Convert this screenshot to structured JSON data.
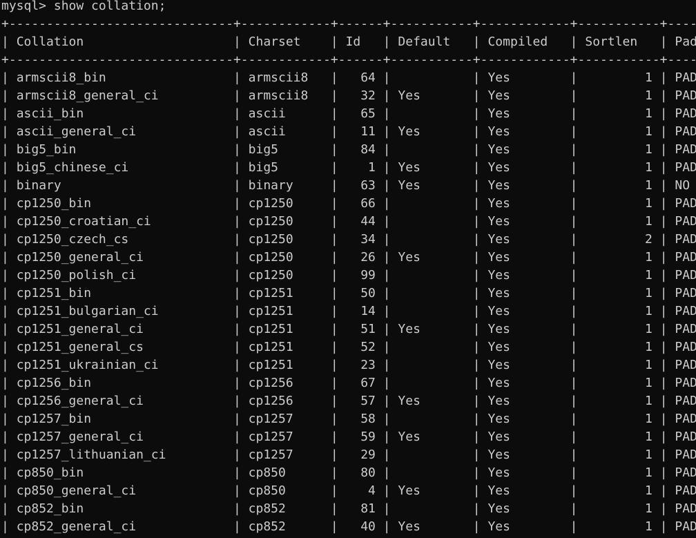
{
  "prompt": "mysql> show collation;",
  "columns": [
    "Collation",
    "Charset",
    "Id",
    "Default",
    "Compiled",
    "Sortlen",
    "Pad_attribute"
  ],
  "rows": [
    [
      "armscii8_bin",
      "armscii8",
      "64",
      "",
      "Yes",
      "1",
      "PAD SPACE"
    ],
    [
      "armscii8_general_ci",
      "armscii8",
      "32",
      "Yes",
      "Yes",
      "1",
      "PAD SPACE"
    ],
    [
      "ascii_bin",
      "ascii",
      "65",
      "",
      "Yes",
      "1",
      "PAD SPACE"
    ],
    [
      "ascii_general_ci",
      "ascii",
      "11",
      "Yes",
      "Yes",
      "1",
      "PAD SPACE"
    ],
    [
      "big5_bin",
      "big5",
      "84",
      "",
      "Yes",
      "1",
      "PAD SPACE"
    ],
    [
      "big5_chinese_ci",
      "big5",
      "1",
      "Yes",
      "Yes",
      "1",
      "PAD SPACE"
    ],
    [
      "binary",
      "binary",
      "63",
      "Yes",
      "Yes",
      "1",
      "NO PAD"
    ],
    [
      "cp1250_bin",
      "cp1250",
      "66",
      "",
      "Yes",
      "1",
      "PAD SPACE"
    ],
    [
      "cp1250_croatian_ci",
      "cp1250",
      "44",
      "",
      "Yes",
      "1",
      "PAD SPACE"
    ],
    [
      "cp1250_czech_cs",
      "cp1250",
      "34",
      "",
      "Yes",
      "2",
      "PAD SPACE"
    ],
    [
      "cp1250_general_ci",
      "cp1250",
      "26",
      "Yes",
      "Yes",
      "1",
      "PAD SPACE"
    ],
    [
      "cp1250_polish_ci",
      "cp1250",
      "99",
      "",
      "Yes",
      "1",
      "PAD SPACE"
    ],
    [
      "cp1251_bin",
      "cp1251",
      "50",
      "",
      "Yes",
      "1",
      "PAD SPACE"
    ],
    [
      "cp1251_bulgarian_ci",
      "cp1251",
      "14",
      "",
      "Yes",
      "1",
      "PAD SPACE"
    ],
    [
      "cp1251_general_ci",
      "cp1251",
      "51",
      "Yes",
      "Yes",
      "1",
      "PAD SPACE"
    ],
    [
      "cp1251_general_cs",
      "cp1251",
      "52",
      "",
      "Yes",
      "1",
      "PAD SPACE"
    ],
    [
      "cp1251_ukrainian_ci",
      "cp1251",
      "23",
      "",
      "Yes",
      "1",
      "PAD SPACE"
    ],
    [
      "cp1256_bin",
      "cp1256",
      "67",
      "",
      "Yes",
      "1",
      "PAD SPACE"
    ],
    [
      "cp1256_general_ci",
      "cp1256",
      "57",
      "Yes",
      "Yes",
      "1",
      "PAD SPACE"
    ],
    [
      "cp1257_bin",
      "cp1257",
      "58",
      "",
      "Yes",
      "1",
      "PAD SPACE"
    ],
    [
      "cp1257_general_ci",
      "cp1257",
      "59",
      "Yes",
      "Yes",
      "1",
      "PAD SPACE"
    ],
    [
      "cp1257_lithuanian_ci",
      "cp1257",
      "29",
      "",
      "Yes",
      "1",
      "PAD SPACE"
    ],
    [
      "cp850_bin",
      "cp850",
      "80",
      "",
      "Yes",
      "1",
      "PAD SPACE"
    ],
    [
      "cp850_general_ci",
      "cp850",
      "4",
      "Yes",
      "Yes",
      "1",
      "PAD SPACE"
    ],
    [
      "cp852_bin",
      "cp852",
      "81",
      "",
      "Yes",
      "1",
      "PAD SPACE"
    ],
    [
      "cp852_general_ci",
      "cp852",
      "40",
      "Yes",
      "Yes",
      "1",
      "PAD SPACE"
    ]
  ],
  "colors": {
    "background": "#0c0c0c",
    "text": "#cccccc"
  }
}
